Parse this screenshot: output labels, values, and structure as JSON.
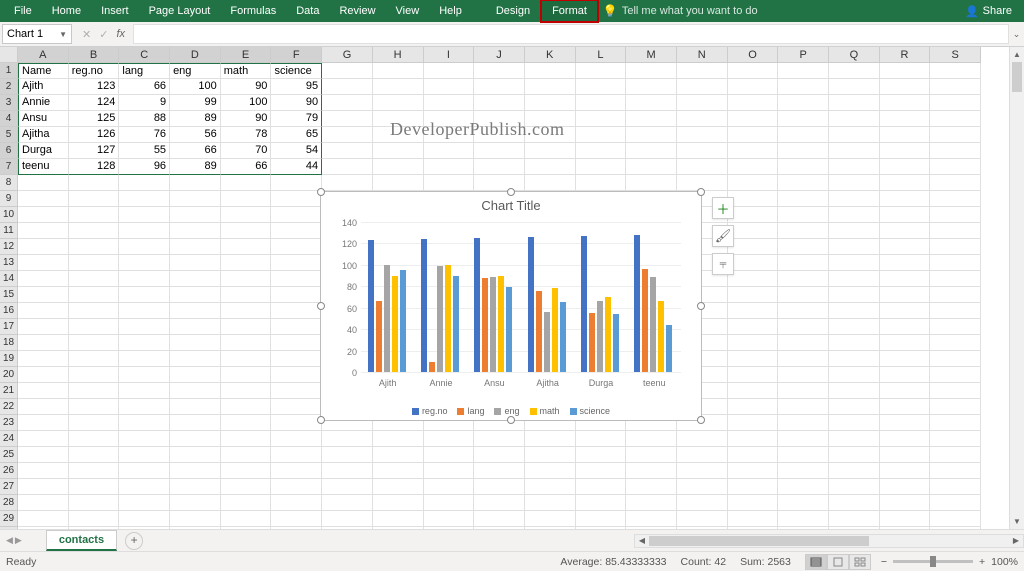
{
  "ribbon": {
    "tabs": [
      "File",
      "Home",
      "Insert",
      "Page Layout",
      "Formulas",
      "Data",
      "Review",
      "View",
      "Help",
      "Design",
      "Format"
    ],
    "highlighted": "Format",
    "tellme": "Tell me what you want to do",
    "share": "Share"
  },
  "namebox": {
    "value": "Chart 1"
  },
  "watermark": "DeveloperPublish.com",
  "columns": [
    "A",
    "B",
    "C",
    "D",
    "E",
    "F",
    "G",
    "H",
    "I",
    "J",
    "K",
    "L",
    "M",
    "N",
    "O",
    "P",
    "Q",
    "R",
    "S"
  ],
  "row_count": 30,
  "table": {
    "headers": [
      "Name",
      "reg.no",
      "lang",
      "eng",
      "math",
      "science"
    ],
    "rows": [
      [
        "Ajith",
        123,
        66,
        100,
        90,
        95
      ],
      [
        "Annie",
        124,
        9,
        99,
        100,
        90
      ],
      [
        "Ansu",
        125,
        88,
        89,
        90,
        79
      ],
      [
        "Ajitha",
        126,
        76,
        56,
        78,
        65
      ],
      [
        "Durga",
        127,
        55,
        66,
        70,
        54
      ],
      [
        "teenu",
        128,
        96,
        89,
        66,
        44
      ]
    ]
  },
  "chart_data": {
    "type": "bar",
    "title": "Chart Title",
    "categories": [
      "Ajith",
      "Annie",
      "Ansu",
      "Ajitha",
      "Durga",
      "teenu"
    ],
    "series": [
      {
        "name": "reg.no",
        "color": "#4472c4",
        "values": [
          123,
          124,
          125,
          126,
          127,
          128
        ]
      },
      {
        "name": "lang",
        "color": "#ed7d31",
        "values": [
          66,
          9,
          88,
          76,
          55,
          96
        ]
      },
      {
        "name": "eng",
        "color": "#a5a5a5",
        "values": [
          100,
          99,
          89,
          56,
          66,
          89
        ]
      },
      {
        "name": "math",
        "color": "#ffc000",
        "values": [
          90,
          100,
          90,
          78,
          70,
          66
        ]
      },
      {
        "name": "science",
        "color": "#5b9bd5",
        "values": [
          95,
          90,
          79,
          65,
          54,
          44
        ]
      }
    ],
    "ylim": [
      0,
      140
    ],
    "yticks": [
      0,
      20,
      40,
      60,
      80,
      100,
      120,
      140
    ]
  },
  "sheets": {
    "active": "contacts"
  },
  "status": {
    "ready": "Ready",
    "avg_label": "Average:",
    "avg": "85.43333333",
    "count_label": "Count:",
    "count": "42",
    "sum_label": "Sum:",
    "sum": "2563",
    "zoom": "100%"
  }
}
